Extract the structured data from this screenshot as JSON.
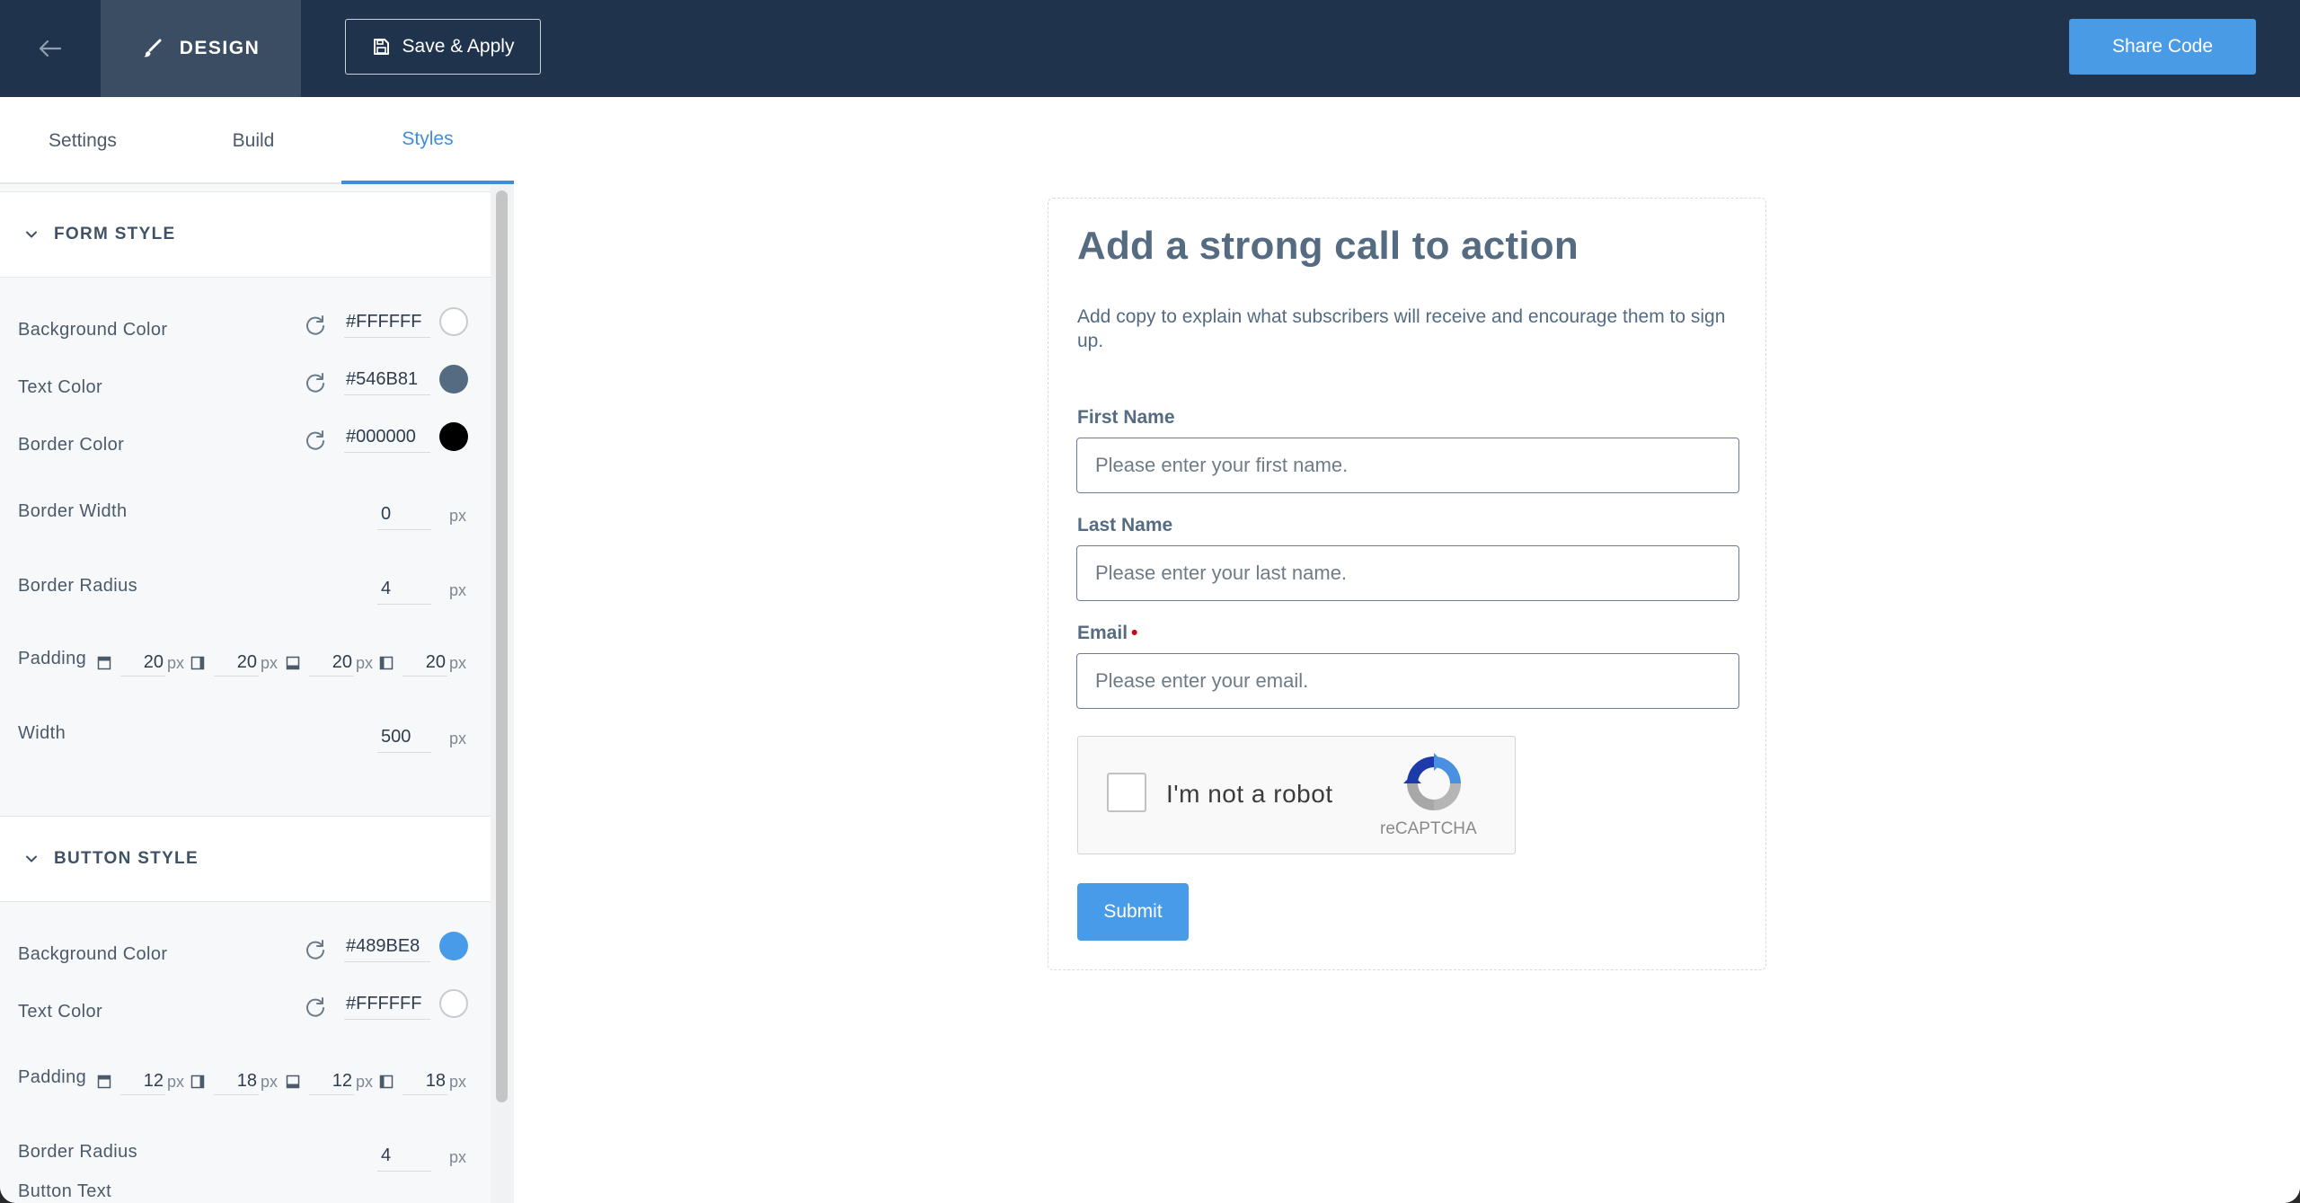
{
  "topbar": {
    "back_icon": "arrow-left-icon",
    "design_label": "DESIGN",
    "design_icon": "brush-icon",
    "save_label": "Save & Apply",
    "save_icon": "save-icon",
    "share_label": "Share Code",
    "colors": {
      "bar": "#1f344c",
      "active_tab": "#3b4d62",
      "accent": "#4a9be6"
    }
  },
  "sidebar": {
    "tabs": [
      {
        "label": "Settings",
        "active": false
      },
      {
        "label": "Build",
        "active": false
      },
      {
        "label": "Styles",
        "active": true
      }
    ],
    "form_style": {
      "title": "FORM STYLE",
      "background_color": {
        "label": "Background Color",
        "value": "#FFFFFF"
      },
      "text_color": {
        "label": "Text Color",
        "value": "#546B81"
      },
      "border_color": {
        "label": "Border Color",
        "value": "#000000"
      },
      "border_width": {
        "label": "Border Width",
        "value": "0",
        "unit": "px"
      },
      "border_radius": {
        "label": "Border Radius",
        "value": "4",
        "unit": "px"
      },
      "padding": {
        "label": "Padding",
        "top": "20",
        "right": "20",
        "bottom": "20",
        "left": "20",
        "unit": "px"
      },
      "width": {
        "label": "Width",
        "value": "500",
        "unit": "px"
      }
    },
    "button_style": {
      "title": "BUTTON STYLE",
      "background_color": {
        "label": "Background Color",
        "value": "#489BE8"
      },
      "text_color": {
        "label": "Text Color",
        "value": "#FFFFFF"
      },
      "padding": {
        "label": "Padding",
        "top": "12",
        "right": "18",
        "bottom": "12",
        "left": "18",
        "unit": "px"
      },
      "border_radius": {
        "label": "Border Radius",
        "value": "4",
        "unit": "px"
      },
      "button_text": {
        "label": "Button Text"
      }
    }
  },
  "preview": {
    "title": "Add a strong call to action",
    "subtitle": "Add copy to explain what subscribers will receive and encourage them to sign up.",
    "fields": [
      {
        "label": "First Name",
        "placeholder": "Please enter your first name.",
        "required": false
      },
      {
        "label": "Last Name",
        "placeholder": "Please enter your last name.",
        "required": false
      },
      {
        "label": "Email",
        "placeholder": "Please enter your email.",
        "required": true,
        "required_mark": "•"
      }
    ],
    "captcha": {
      "text": "I'm not a robot",
      "brand": "reCAPTCHA"
    },
    "submit_label": "Submit"
  }
}
